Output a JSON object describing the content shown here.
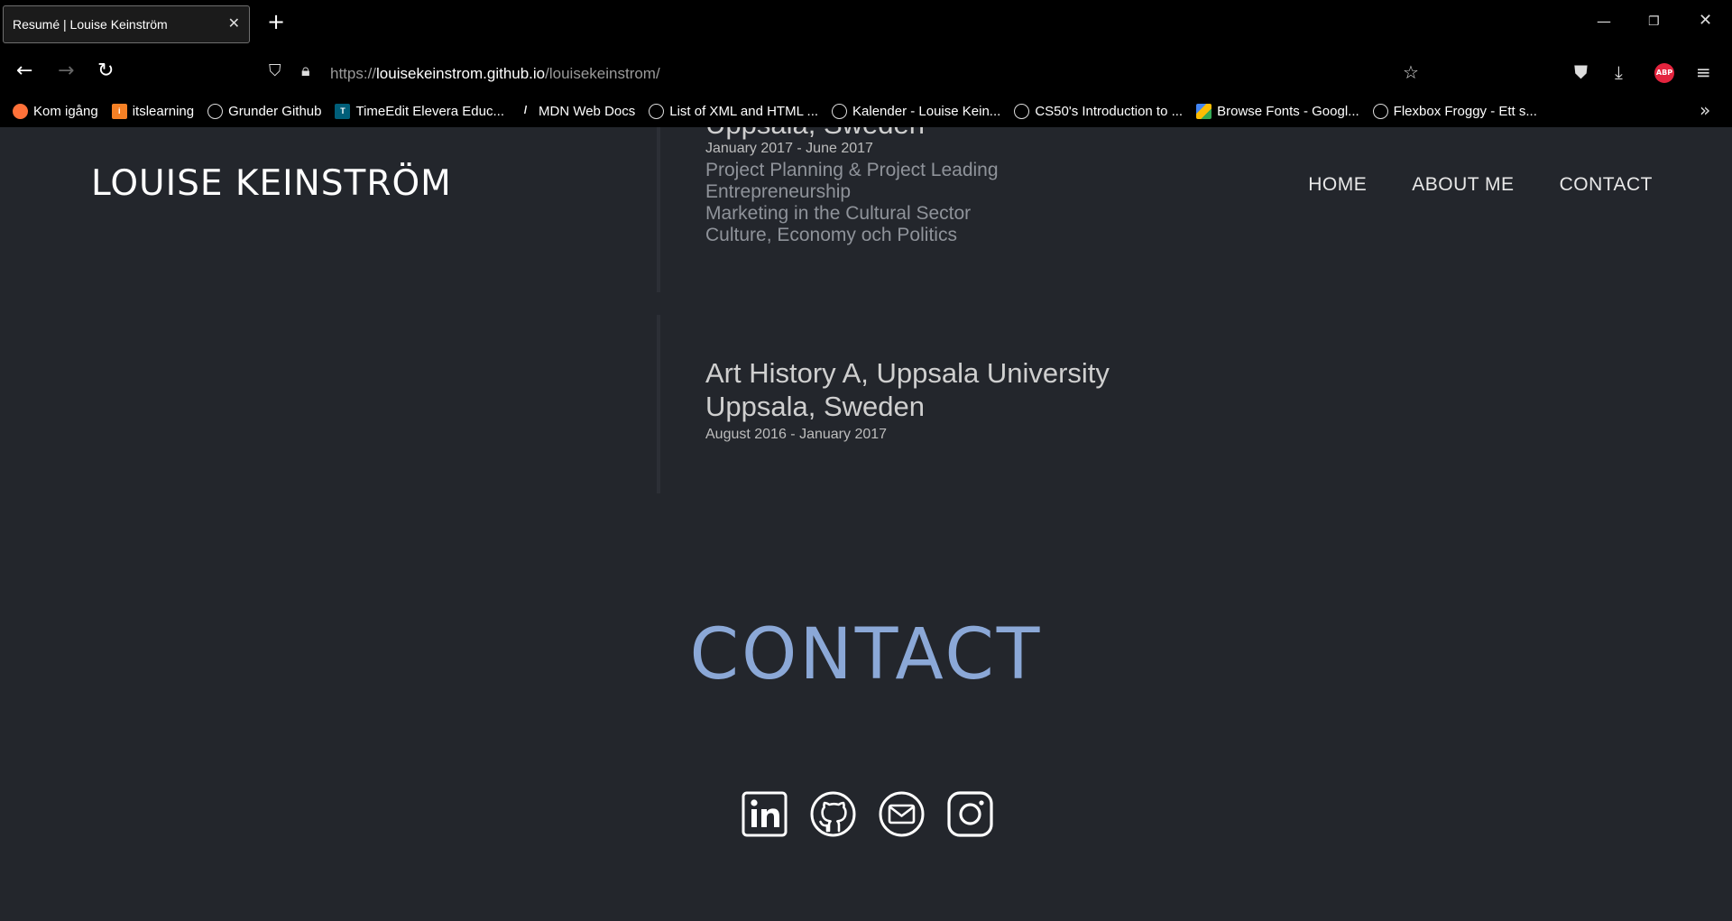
{
  "browser": {
    "tab_title": "Resumé | Louise Keinström",
    "url_scheme": "https://",
    "url_host": "louisekeinstrom.github.io",
    "url_path": "/louisekeinstrom/",
    "bookmarks": [
      {
        "label": "Kom igång",
        "icon": "firefox-icon"
      },
      {
        "label": "itslearning",
        "icon": "itslearning-icon"
      },
      {
        "label": "Grunder Github",
        "icon": "globe-icon"
      },
      {
        "label": "TimeEdit Elevera Educ...",
        "icon": "timeedit-icon"
      },
      {
        "label": "MDN Web Docs",
        "icon": "mdn-icon"
      },
      {
        "label": "List of XML and HTML ...",
        "icon": "globe-icon"
      },
      {
        "label": "Kalender - Louise Kein...",
        "icon": "globe-icon"
      },
      {
        "label": "CS50's Introduction to ...",
        "icon": "globe-icon"
      },
      {
        "label": "Browse Fonts - Googl...",
        "icon": "google-fonts-icon"
      },
      {
        "label": "Flexbox Froggy - Ett s...",
        "icon": "globe-icon"
      }
    ],
    "abp_label": "ABP"
  },
  "site": {
    "logo": "LOUISE KEINSTRÖM",
    "nav": [
      "HOME",
      "ABOUT ME",
      "CONTACT"
    ]
  },
  "education": [
    {
      "location_partial": "Uppsala, Sweden",
      "dates": "January 2017 - June 2017",
      "courses": [
        "Project Planning & Project Leading",
        "Entrepreneurship",
        "Marketing in the Cultural Sector",
        "Culture, Economy och Politics"
      ]
    },
    {
      "title": "Art History A, Uppsala University",
      "location": "Uppsala, Sweden",
      "dates": "August 2016 - January 2017"
    }
  ],
  "contact": {
    "heading": "CONTACT",
    "socials": [
      "linkedin-icon",
      "github-icon",
      "email-icon",
      "instagram-icon"
    ]
  },
  "colors": {
    "page_bg": "#23262c",
    "contact_heading": "#8ba8d7",
    "chrome_bg": "#000000"
  }
}
